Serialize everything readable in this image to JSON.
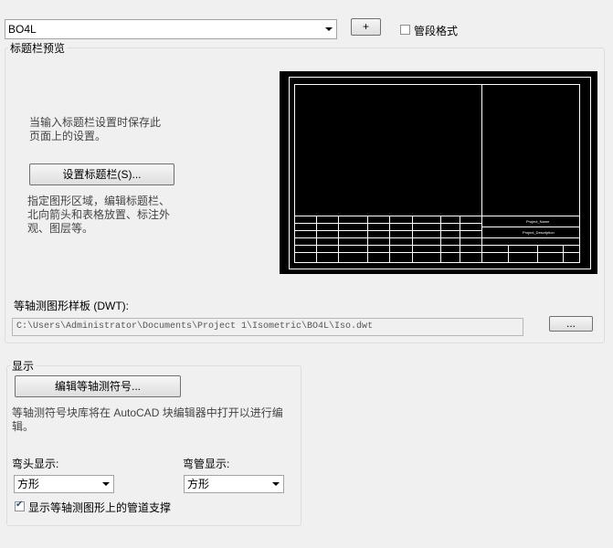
{
  "top": {
    "template_value": "BO4L",
    "add_label": "+",
    "pipe_format_label": "管段格式",
    "pipe_format_checked": false
  },
  "titleblock": {
    "group_label": "标题栏预览",
    "desc_save": "当输入标题栏设置时保存此页面上的设置。",
    "setup_button": "设置标题栏(S)...",
    "desc_area": "指定图形区域，编辑标题栏、北向箭头和表格放置、标注外观、图层等。",
    "preview": {
      "project_name": "Project_Name",
      "project_description": "Project_Description"
    }
  },
  "dwt": {
    "label": "等轴测图形样板 (DWT):",
    "path": "C:\\Users\\Administrator\\Documents\\Project 1\\Isometric\\BO4L\\Iso.dwt",
    "browse_label": "..."
  },
  "display": {
    "group_label": "显示",
    "edit_symbols_button": "编辑等轴测符号...",
    "desc": "等轴测符号块库将在 AutoCAD 块编辑器中打开以进行编辑。",
    "elbow_label": "弯头显示:",
    "elbow_value": "方形",
    "bend_label": "弯管显示:",
    "bend_value": "方形",
    "support_label": "显示等轴测图形上的管道支撑",
    "support_checked": true
  }
}
